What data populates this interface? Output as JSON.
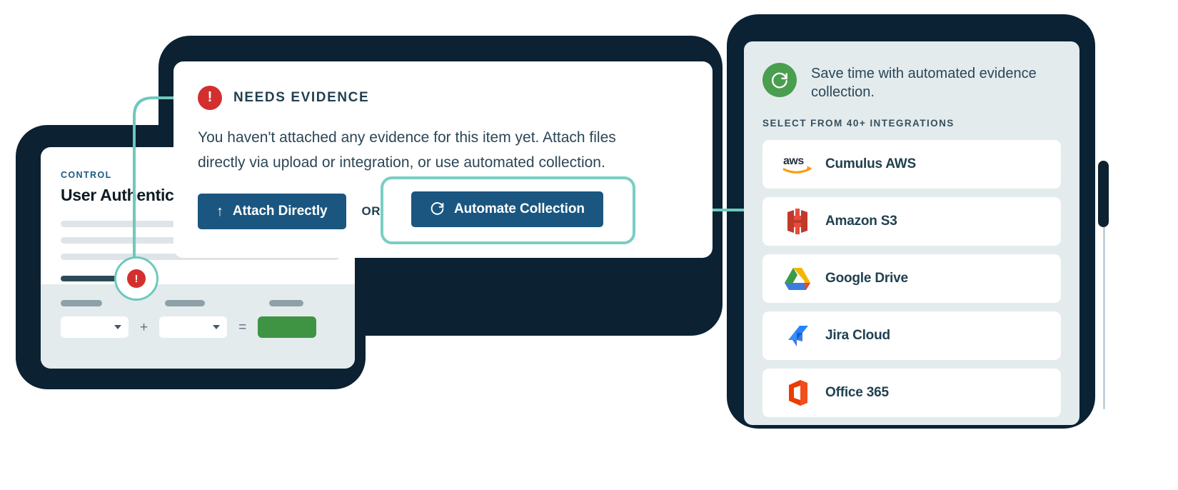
{
  "colors": {
    "navy_dark": "#0c2233",
    "navy_panel": "#0a2234",
    "teal_accent": "#6dc9bd",
    "button_blue": "#1a5680",
    "alert_red": "#d32f2f",
    "green": "#4a9e4f",
    "green_box": "#3f9444",
    "panel_bg": "#e3ebed"
  },
  "control_card": {
    "eyebrow": "CONTROL",
    "title": "User Authentication",
    "status_icon": "alert-exclamation-icon",
    "operators": {
      "plus": "+",
      "equals": "="
    },
    "select_left_value": "",
    "select_right_value": ""
  },
  "evidence_card": {
    "status_icon": "alert-exclamation-icon",
    "status_label": "NEEDS EVIDENCE",
    "body": "You haven't attached any evidence for this item yet. Attach files directly via upload or integration, or use automated collection.",
    "attach_button": {
      "label": "Attach Directly",
      "icon": "upload-arrow-icon",
      "glyph": "↑"
    },
    "or_label": "OR",
    "automate_button": {
      "label": "Automate Collection",
      "icon": "refresh-icon"
    }
  },
  "integrations_panel": {
    "refresh_icon": "refresh-circle-icon",
    "headline": "Save time with automated evidence collection.",
    "section_heading": "SELECT FROM 40+ INTEGRATIONS",
    "items": [
      {
        "label": "Cumulus AWS",
        "icon": "aws-logo-icon"
      },
      {
        "label": "Amazon S3",
        "icon": "amazon-s3-logo-icon"
      },
      {
        "label": "Google Drive",
        "icon": "google-drive-logo-icon"
      },
      {
        "label": "Jira Cloud",
        "icon": "jira-logo-icon"
      },
      {
        "label": "Office 365",
        "icon": "office365-logo-icon"
      }
    ],
    "scrollbar": {
      "position": "top"
    }
  }
}
